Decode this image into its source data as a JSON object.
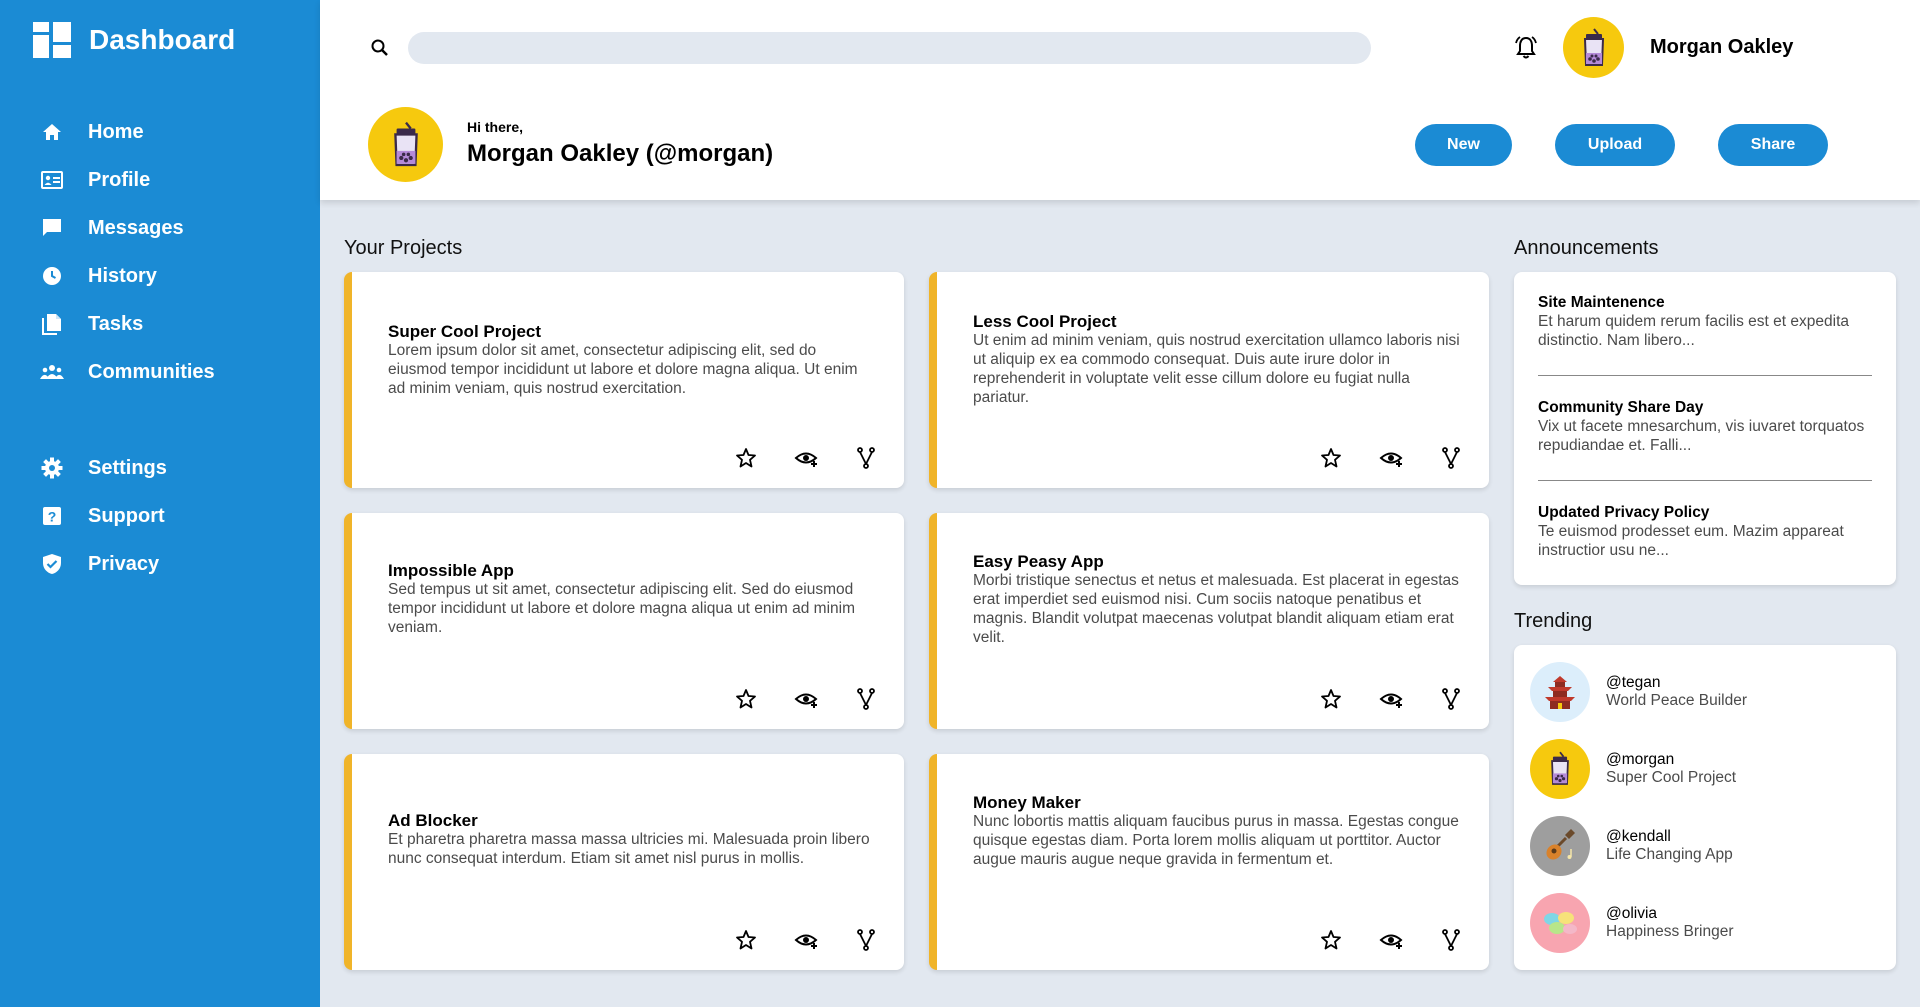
{
  "sidebar": {
    "brand": "Dashboard",
    "items": [
      {
        "label": "Home",
        "icon": "home-icon"
      },
      {
        "label": "Profile",
        "icon": "id-card-icon"
      },
      {
        "label": "Messages",
        "icon": "chat-icon"
      },
      {
        "label": "History",
        "icon": "clock-icon"
      },
      {
        "label": "Tasks",
        "icon": "document-icon"
      },
      {
        "label": "Communities",
        "icon": "people-icon"
      }
    ],
    "items2": [
      {
        "label": "Settings",
        "icon": "gear-icon"
      },
      {
        "label": "Support",
        "icon": "help-icon"
      },
      {
        "label": "Privacy",
        "icon": "shield-icon"
      }
    ]
  },
  "header": {
    "search_placeholder": "",
    "user_name": "Morgan Oakley",
    "greeting": "Hi there,",
    "full_name": "Morgan Oakley (@morgan)",
    "buttons": {
      "new": "New",
      "upload": "Upload",
      "share": "Share"
    }
  },
  "projects": {
    "title": "Your Projects",
    "items": [
      {
        "title": "Super Cool Project",
        "desc": "Lorem ipsum dolor sit amet, consectetur adipiscing elit, sed do eiusmod tempor incididunt ut labore et dolore magna aliqua. Ut enim ad minim veniam, quis nostrud exercitation."
      },
      {
        "title": "Less Cool Project",
        "desc": "Ut enim ad minim veniam, quis nostrud exercitation ullamco laboris nisi ut aliquip ex ea commodo consequat. Duis aute irure dolor in reprehenderit in voluptate velit esse cillum dolore eu fugiat nulla pariatur."
      },
      {
        "title": "Impossible App",
        "desc": "Sed tempus ut sit amet, consectetur adipiscing elit. Sed do eiusmod tempor incididunt ut labore et dolore magna aliqua ut enim ad minim veniam."
      },
      {
        "title": "Easy Peasy App",
        "desc": "Morbi tristique senectus et netus et malesuada. Est placerat in egestas erat imperdiet sed euismod nisi. Cum sociis natoque penatibus et magnis. Blandit volutpat maecenas volutpat blandit aliquam etiam erat velit."
      },
      {
        "title": "Ad Blocker",
        "desc": "Et pharetra pharetra massa massa ultricies mi. Malesuada proin libero nunc consequat interdum. Etiam sit amet nisl purus in mollis."
      },
      {
        "title": "Money Maker",
        "desc": "Nunc lobortis mattis aliquam faucibus purus in massa. Egestas congue quisque egestas diam. Porta lorem mollis aliquam ut porttitor. Auctor augue mauris augue neque gravida in fermentum et."
      }
    ]
  },
  "announcements": {
    "title": "Announcements",
    "items": [
      {
        "title": "Site Maintenence",
        "desc": "Et harum quidem rerum facilis est et expedita distinctio. Nam libero..."
      },
      {
        "title": "Community Share Day",
        "desc": "Vix ut facete mnesarchum, vis iuvaret torquatos repudiandae et. Falli..."
      },
      {
        "title": "Updated Privacy Policy",
        "desc": "Te euismod prodesset eum. Mazim appareat instructior usu ne..."
      }
    ]
  },
  "trending": {
    "title": "Trending",
    "items": [
      {
        "handle": "@tegan",
        "project": "World Peace Builder",
        "color": "#dceefb"
      },
      {
        "handle": "@morgan",
        "project": "Super Cool Project",
        "color": "#f6c90e"
      },
      {
        "handle": "@kendall",
        "project": "Life Changing App",
        "color": "#9e9e9e"
      },
      {
        "handle": "@olivia",
        "project": "Happiness Bringer",
        "color": "#f8a5b0"
      }
    ]
  },
  "colors": {
    "accent": "#1b8bd4",
    "card_border": "#f0b429",
    "avatar_bg": "#f6c90e",
    "background": "#e2e8f0"
  }
}
